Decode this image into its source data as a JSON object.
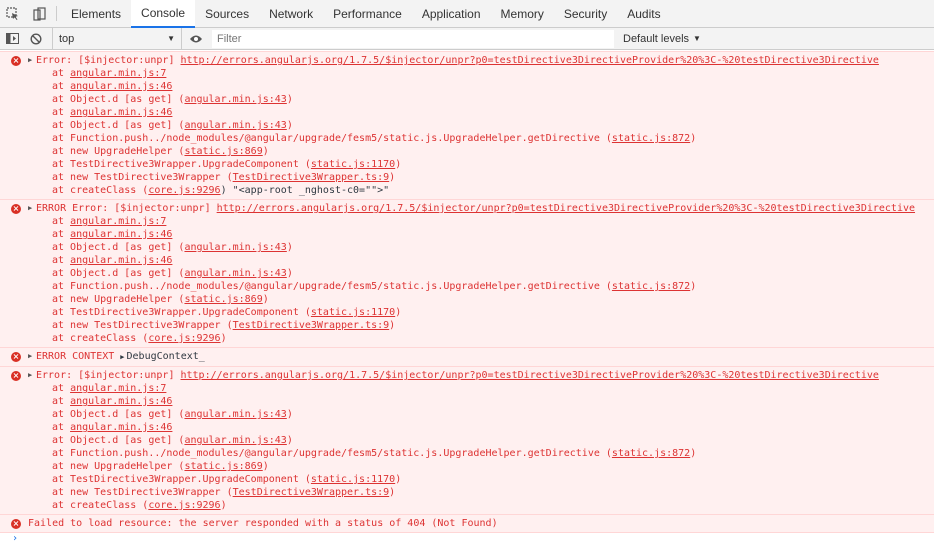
{
  "tabs": [
    {
      "label": "Elements"
    },
    {
      "label": "Console"
    },
    {
      "label": "Sources"
    },
    {
      "label": "Network"
    },
    {
      "label": "Performance"
    },
    {
      "label": "Application"
    },
    {
      "label": "Memory"
    },
    {
      "label": "Security"
    },
    {
      "label": "Audits"
    }
  ],
  "toolbar": {
    "context": "top",
    "filter_placeholder": "Filter",
    "levels": "Default levels"
  },
  "errors": [
    {
      "prefix": "Error: [$injector:unpr] ",
      "url": "http://errors.angularjs.org/1.7.5/$injector/unpr?p0=testDirective3DirectiveProvider%20%3C-%20testDirective3Directive",
      "stack": [
        {
          "pre": "at ",
          "text": "",
          "link": "angular.min.js:7",
          "post": ""
        },
        {
          "pre": "at ",
          "text": "",
          "link": "angular.min.js:46",
          "post": ""
        },
        {
          "pre": "at Object.d [as get] (",
          "text": "",
          "link": "angular.min.js:43",
          "post": ")"
        },
        {
          "pre": "at ",
          "text": "",
          "link": "angular.min.js:46",
          "post": ""
        },
        {
          "pre": "at Object.d [as get] (",
          "text": "",
          "link": "angular.min.js:43",
          "post": ")"
        },
        {
          "pre": "at Function.push../node_modules/@angular/upgrade/fesm5/static.js.UpgradeHelper.getDirective (",
          "text": "",
          "link": "static.js:872",
          "post": ")"
        },
        {
          "pre": "at new UpgradeHelper (",
          "text": "",
          "link": "static.js:869",
          "post": ")"
        },
        {
          "pre": "at TestDirective3Wrapper.UpgradeComponent (",
          "text": "",
          "link": "static.js:1170",
          "post": ")"
        },
        {
          "pre": "at new TestDirective3Wrapper (",
          "text": "",
          "link": "TestDirective3Wrapper.ts:9",
          "post": ")"
        },
        {
          "pre": "at createClass (",
          "text": "",
          "link": "core.js:9296",
          "post": ") \"<app-root _nghost-c0=\"\">\""
        }
      ]
    },
    {
      "prefix": "ERROR Error: [$injector:unpr] ",
      "url": "http://errors.angularjs.org/1.7.5/$injector/unpr?p0=testDirective3DirectiveProvider%20%3C-%20testDirective3Directive",
      "stack": [
        {
          "pre": "at ",
          "text": "",
          "link": "angular.min.js:7",
          "post": ""
        },
        {
          "pre": "at ",
          "text": "",
          "link": "angular.min.js:46",
          "post": ""
        },
        {
          "pre": "at Object.d [as get] (",
          "text": "",
          "link": "angular.min.js:43",
          "post": ")"
        },
        {
          "pre": "at ",
          "text": "",
          "link": "angular.min.js:46",
          "post": ""
        },
        {
          "pre": "at Object.d [as get] (",
          "text": "",
          "link": "angular.min.js:43",
          "post": ")"
        },
        {
          "pre": "at Function.push../node_modules/@angular/upgrade/fesm5/static.js.UpgradeHelper.getDirective (",
          "text": "",
          "link": "static.js:872",
          "post": ")"
        },
        {
          "pre": "at new UpgradeHelper (",
          "text": "",
          "link": "static.js:869",
          "post": ")"
        },
        {
          "pre": "at TestDirective3Wrapper.UpgradeComponent (",
          "text": "",
          "link": "static.js:1170",
          "post": ")"
        },
        {
          "pre": "at new TestDirective3Wrapper (",
          "text": "",
          "link": "TestDirective3Wrapper.ts:9",
          "post": ")"
        },
        {
          "pre": "at createClass (",
          "text": "",
          "link": "core.js:9296",
          "post": ")"
        }
      ]
    },
    {
      "context_line": true,
      "prefix": "ERROR CONTEXT ",
      "value": "DebugContext_"
    },
    {
      "prefix": "Error: [$injector:unpr] ",
      "url": "http://errors.angularjs.org/1.7.5/$injector/unpr?p0=testDirective3DirectiveProvider%20%3C-%20testDirective3Directive",
      "stack": [
        {
          "pre": "at ",
          "text": "",
          "link": "angular.min.js:7",
          "post": ""
        },
        {
          "pre": "at ",
          "text": "",
          "link": "angular.min.js:46",
          "post": ""
        },
        {
          "pre": "at Object.d [as get] (",
          "text": "",
          "link": "angular.min.js:43",
          "post": ")"
        },
        {
          "pre": "at ",
          "text": "",
          "link": "angular.min.js:46",
          "post": ""
        },
        {
          "pre": "at Object.d [as get] (",
          "text": "",
          "link": "angular.min.js:43",
          "post": ")"
        },
        {
          "pre": "at Function.push../node_modules/@angular/upgrade/fesm5/static.js.UpgradeHelper.getDirective (",
          "text": "",
          "link": "static.js:872",
          "post": ")"
        },
        {
          "pre": "at new UpgradeHelper (",
          "text": "",
          "link": "static.js:869",
          "post": ")"
        },
        {
          "pre": "at TestDirective3Wrapper.UpgradeComponent (",
          "text": "",
          "link": "static.js:1170",
          "post": ")"
        },
        {
          "pre": "at new TestDirective3Wrapper (",
          "text": "",
          "link": "TestDirective3Wrapper.ts:9",
          "post": ")"
        },
        {
          "pre": "at createClass (",
          "text": "",
          "link": "core.js:9296",
          "post": ")"
        }
      ]
    },
    {
      "simple": true,
      "prefix": "Failed to load resource: the server responded with a status of 404 (Not Found)"
    }
  ],
  "colors": {
    "error_text": "#d33",
    "error_bg": "#fff0f0",
    "accent": "#1a73e8"
  }
}
